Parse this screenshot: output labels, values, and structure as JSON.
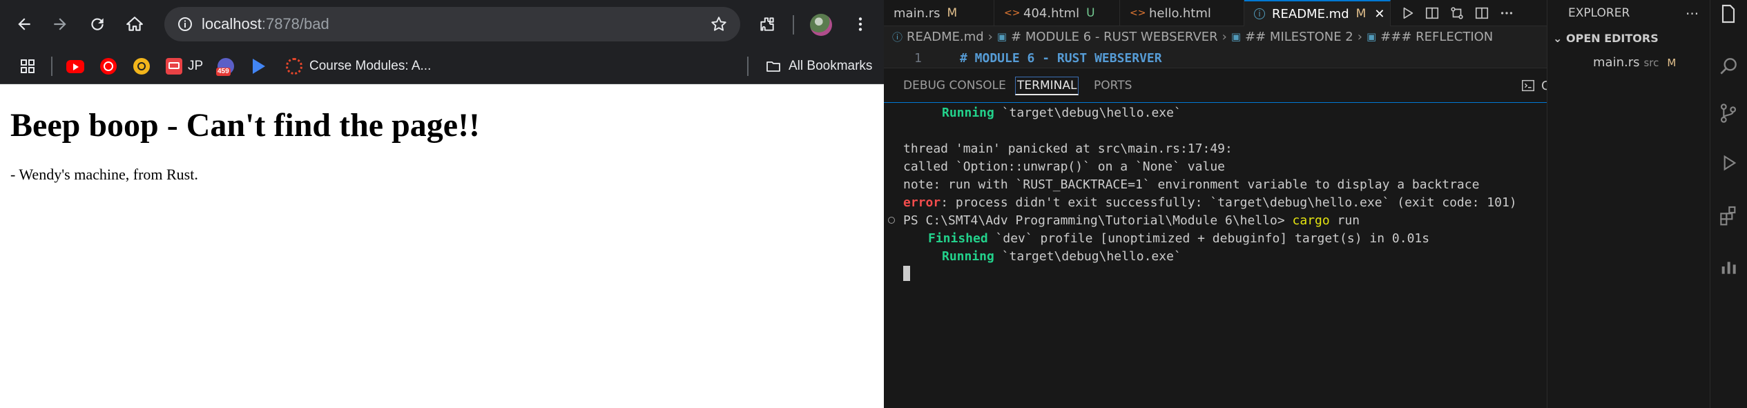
{
  "browser": {
    "url_host": "localhost",
    "url_rest": ":7878/bad",
    "bookmarks": [
      {
        "label": "",
        "icon": "youtube-icon",
        "color": "#ff0000"
      },
      {
        "label": "",
        "icon": "youtube-music-icon",
        "color": "#ff0000"
      },
      {
        "label": "",
        "icon": "app-icon",
        "color": "#f2b51b"
      },
      {
        "label": "JP",
        "icon": "jp-icon",
        "color": "#e94245"
      },
      {
        "label": "",
        "icon": "badge-icon",
        "color": "#5b5fc7",
        "badge": "459"
      },
      {
        "label": "",
        "icon": "play-icon",
        "color": "#4285f4"
      },
      {
        "label": "Course Modules: A...",
        "icon": "course-icon",
        "color": "#e8472b"
      }
    ],
    "all_bookmarks_label": "All Bookmarks",
    "page_heading": "Beep boop - Can't find the page!!",
    "page_text": "- Wendy's machine, from Rust."
  },
  "vscode": {
    "tabs": [
      {
        "label": "main.rs",
        "status": "M"
      },
      {
        "label": "404.html",
        "status": "U"
      },
      {
        "label": "hello.html",
        "status": ""
      },
      {
        "label": "README.md",
        "status": "M"
      }
    ],
    "breadcrumb": [
      "README.md",
      "# MODULE 6 - RUST WEBSERVER",
      "## MILESTONE 2",
      "### REFLECTION"
    ],
    "editor_line_number": "1",
    "editor_line_text": "# MODULE 6 - RUST WEBSERVER",
    "panel_tabs": [
      "DEBUG CONSOLE",
      "TERMINAL",
      "PORTS"
    ],
    "terminal_shell_label": "Code",
    "terminal": {
      "l1_kw": "Running",
      "l1_rest": "`target\\debug\\hello.exe`",
      "l2": "thread 'main' panicked at src\\main.rs:17:49:",
      "l3": "called `Option::unwrap()` on a `None` value",
      "l4": "note: run with `RUST_BACKTRACE=1` environment variable to display a backtrace",
      "l5_kw": "error",
      "l5_rest": ": process didn't exit successfully: `target\\debug\\hello.exe` (exit code: 101)",
      "l6_prompt": "PS C:\\SMT4\\Adv Programming\\Tutorial\\Module 6\\hello> ",
      "l6_cmd": "cargo",
      "l6_arg": " run",
      "l7_kw": "Finished",
      "l7_rest": " `dev` profile [unoptimized + debuginfo] target(s) in 0.01s",
      "l8_kw": "Running",
      "l8_rest": " `target\\debug\\hello.exe`"
    },
    "explorer": {
      "title": "EXPLORER",
      "section": "OPEN EDITORS",
      "file_name": "main.rs",
      "file_folder": "src",
      "file_status": "M"
    },
    "colors": {
      "accent": "#0078d4",
      "green": "#23d18b",
      "red": "#f14c4c",
      "yellow": "#e5e510"
    }
  }
}
